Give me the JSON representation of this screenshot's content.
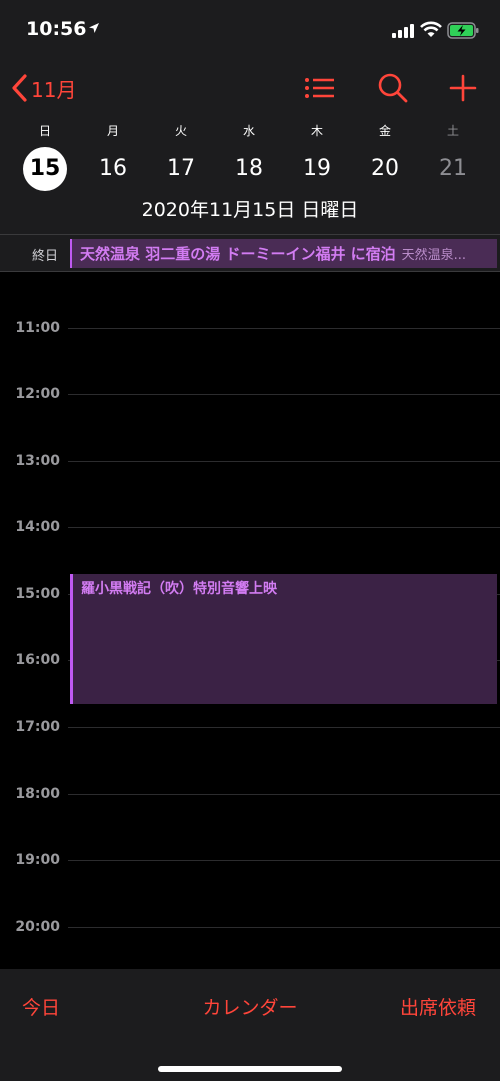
{
  "status_bar": {
    "time": "10:56",
    "icons": [
      "location-arrow-icon",
      "cellular-signal-icon",
      "wifi-icon",
      "battery-charging-icon"
    ]
  },
  "nav": {
    "back_label": "11月",
    "icons": [
      "list-icon",
      "search-icon",
      "add-icon"
    ],
    "accent_color": "#ff453a"
  },
  "week": {
    "days": [
      {
        "weekday": "日",
        "date": "15",
        "selected": true
      },
      {
        "weekday": "月",
        "date": "16"
      },
      {
        "weekday": "火",
        "date": "17"
      },
      {
        "weekday": "水",
        "date": "18"
      },
      {
        "weekday": "木",
        "date": "19"
      },
      {
        "weekday": "金",
        "date": "20"
      },
      {
        "weekday": "土",
        "date": "21"
      }
    ],
    "full_date": "2020年11月15日 日曜日"
  },
  "all_day": {
    "label": "終日",
    "event_title": "天然温泉 羽二重の湯 ドーミーイン福井 に宿泊",
    "event_location": "天然温泉...",
    "color": "#bf5af2"
  },
  "timeline": {
    "hours": [
      "11:00",
      "12:00",
      "13:00",
      "14:00",
      "15:00",
      "16:00",
      "17:00",
      "18:00",
      "19:00",
      "20:00"
    ],
    "events": [
      {
        "title": "羅小黒戦記（吹）特別音響上映"
      }
    ]
  },
  "tabbar": {
    "today": "今日",
    "calendars": "カレンダー",
    "inbox": "出席依頼"
  }
}
